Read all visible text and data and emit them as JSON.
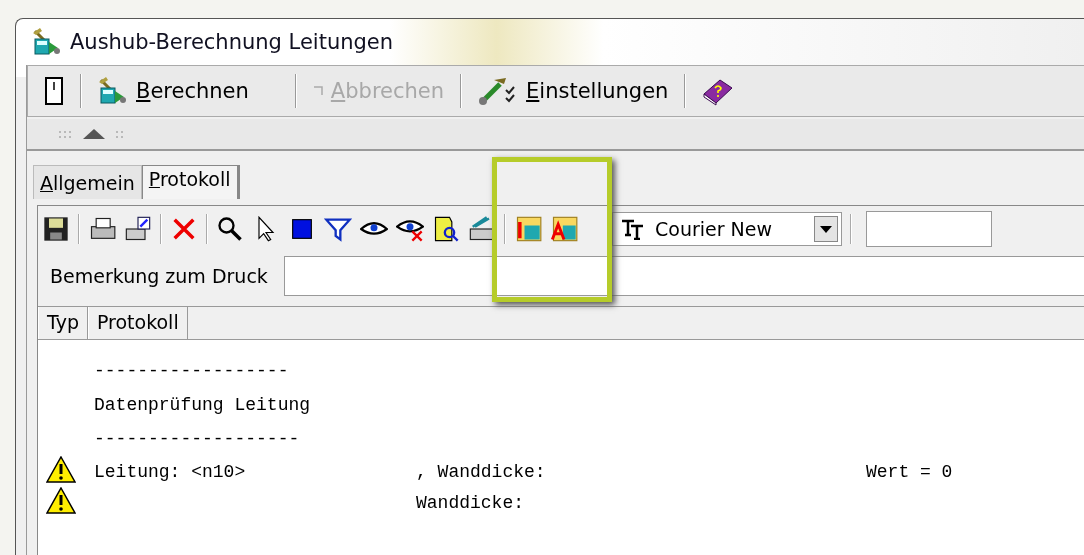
{
  "window": {
    "title": "Aushub-Berechnung Leitungen"
  },
  "toolbar": [
    {
      "kind": "button",
      "label": "Berechnen",
      "disabled": false
    },
    {
      "kind": "button",
      "label": "Abbrechen",
      "disabled": true
    },
    {
      "kind": "button",
      "label": "Einstellungen",
      "disabled": false
    }
  ],
  "tabs": [
    {
      "label": "Allgemein",
      "selected": false
    },
    {
      "label": "Protokoll",
      "selected": true
    }
  ],
  "font_dropdown": {
    "value": "Courier New"
  },
  "remark": {
    "label": "Bemerkung zum Druck"
  },
  "table": {
    "columns": [
      "Typ",
      "Protokoll"
    ],
    "rows": [
      {
        "kind": "text",
        "text": "------------------"
      },
      {
        "kind": "text",
        "text": "Datenprüfung Leitung"
      },
      {
        "kind": "text",
        "text": "-------------------"
      },
      {
        "kind": "warning",
        "name": "Leitung: <n10>",
        "field": ", Wanddicke:",
        "value": "Wert = 0"
      },
      {
        "kind": "warning",
        "field": "Wanddicke:"
      }
    ]
  }
}
